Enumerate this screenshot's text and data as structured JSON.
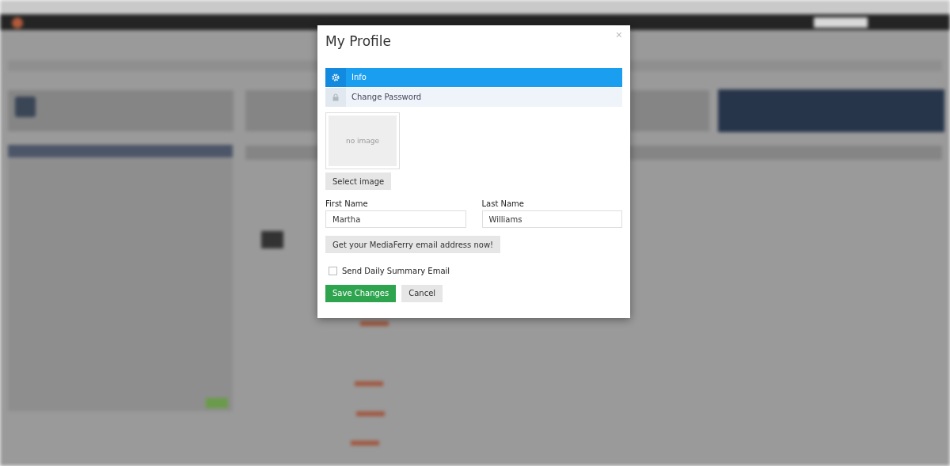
{
  "dialog": {
    "title": "My Profile",
    "close": "×",
    "tabs": [
      {
        "label": "Info",
        "kind": "gear",
        "selected": true
      },
      {
        "label": "Change Password",
        "kind": "lock",
        "selected": false
      }
    ],
    "avatar": {
      "caption": "no image"
    },
    "select_image": "Select image",
    "fields": [
      {
        "label": "First Name",
        "value": "Martha"
      },
      {
        "label": "Last Name",
        "value": "Williams"
      }
    ],
    "email_button": "Get your MediaFerry email address now!",
    "daily_summary": {
      "label": "Send Daily Summary Email",
      "checked": false
    },
    "buttons": [
      {
        "label": "Save Changes",
        "kind": "primary"
      },
      {
        "label": "Cancel",
        "kind": "default"
      }
    ]
  }
}
